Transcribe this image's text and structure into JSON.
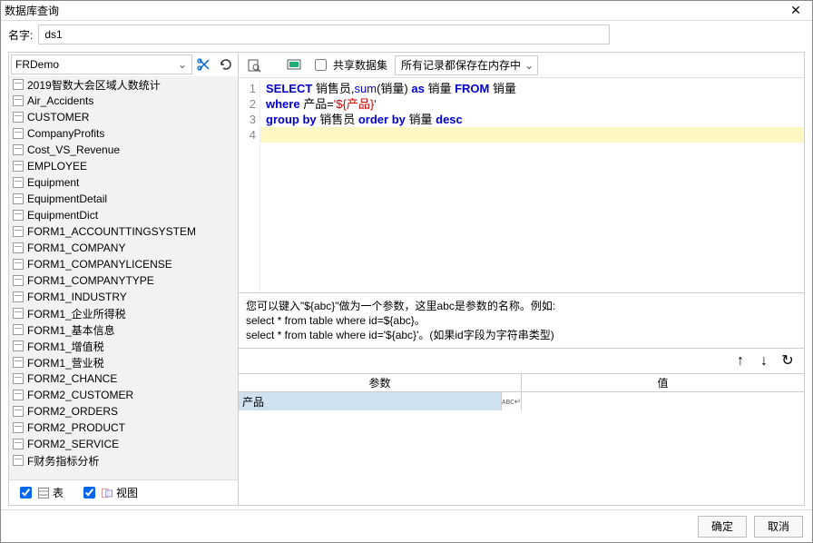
{
  "window": {
    "title": "数据库查询"
  },
  "name": {
    "label": "名字:",
    "value": "ds1"
  },
  "datasource": {
    "value": "FRDemo"
  },
  "tables": [
    "2019智数大会区域人数统计",
    "Air_Accidents",
    "CUSTOMER",
    "CompanyProfits",
    "Cost_VS_Revenue",
    "EMPLOYEE",
    "Equipment",
    "EquipmentDetail",
    "EquipmentDict",
    "FORM1_ACCOUNTTINGSYSTEM",
    "FORM1_COMPANY",
    "FORM1_COMPANYLICENSE",
    "FORM1_COMPANYTYPE",
    "FORM1_INDUSTRY",
    "FORM1_企业所得税",
    "FORM1_基本信息",
    "FORM1_增值税",
    "FORM1_营业税",
    "FORM2_CHANCE",
    "FORM2_CUSTOMER",
    "FORM2_ORDERS",
    "FORM2_PRODUCT",
    "FORM2_SERVICE",
    "F财务指标分析"
  ],
  "leftBottom": {
    "table": "表",
    "view": "视图"
  },
  "toolbar": {
    "share": "共享数据集",
    "records": "所有记录都保存在内存中"
  },
  "sql": {
    "l1_p1": "SELECT",
    "l1_p2": " 销售员,",
    "l1_p3": "sum",
    "l1_p4": "(销量) ",
    "l1_p5": "as",
    "l1_p6": " 销量 ",
    "l1_p7": "FROM",
    "l1_p8": " 销量",
    "l2_p1": "where",
    "l2_p2": " 产品=",
    "l2_p3": "'${产品}'",
    "l3_p1": "group",
    "l3_p2": " ",
    "l3_p3": "by",
    "l3_p4": " 销售员 ",
    "l3_p5": "order",
    "l3_p6": " ",
    "l3_p7": "by",
    "l3_p8": " 销量 ",
    "l3_p9": "desc"
  },
  "gutter": {
    "n1": "1",
    "n2": "2",
    "n3": "3",
    "n4": "4"
  },
  "help": {
    "l1": "您可以键入\"${abc}\"做为一个参数，这里abc是参数的名称。例如:",
    "l2": "select * from table where id=${abc}。",
    "l3": "select * from table where id='${abc}'。(如果id字段为字符串类型)"
  },
  "params": {
    "colParam": "参数",
    "colValue": "值",
    "rows": [
      {
        "name": "产品",
        "type": "ᴀʙᴄ↵",
        "value": ""
      }
    ]
  },
  "footer": {
    "ok": "确定",
    "cancel": "取消"
  }
}
